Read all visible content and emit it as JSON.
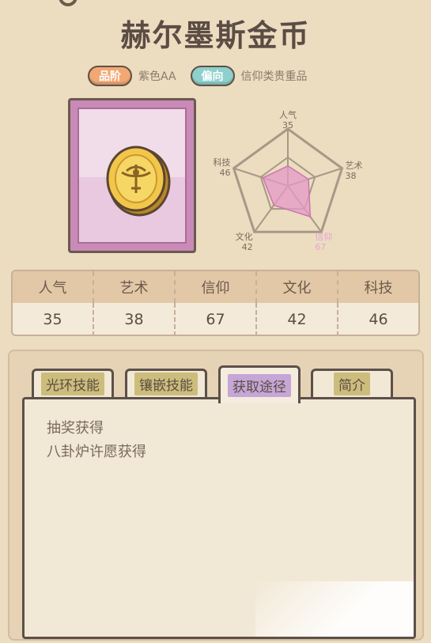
{
  "item": {
    "name": "赫尔墨斯金币"
  },
  "tags": {
    "quality_label": "品阶",
    "quality_value": "紫色AA",
    "tendency_label": "偏向",
    "tendency_value": "信仰类贵重品"
  },
  "radar": {
    "axes": [
      {
        "name": "人气",
        "value": 35
      },
      {
        "name": "艺术",
        "value": 38
      },
      {
        "name": "信仰",
        "value": 67
      },
      {
        "name": "文化",
        "value": 42
      },
      {
        "name": "科技",
        "value": 46
      }
    ],
    "max": 100,
    "fill_color": "#e59ac7",
    "highlight_color": "#e3a7d0"
  },
  "stats": {
    "headers": [
      "人气",
      "艺术",
      "信仰",
      "文化",
      "科技"
    ],
    "values": [
      "35",
      "38",
      "67",
      "42",
      "46"
    ]
  },
  "tabs": [
    {
      "label": "光环技能",
      "active": false
    },
    {
      "label": "镶嵌技能",
      "active": false
    },
    {
      "label": "获取途径",
      "active": true
    },
    {
      "label": "简介",
      "active": false
    }
  ],
  "content": {
    "lines": [
      "抽奖获得",
      "八卦炉许愿获得"
    ]
  },
  "colors": {
    "card_frame": "#c98ab8",
    "tab_label_bg": "#cdbd7c",
    "tab_active_bg": "#c6a6d6"
  }
}
